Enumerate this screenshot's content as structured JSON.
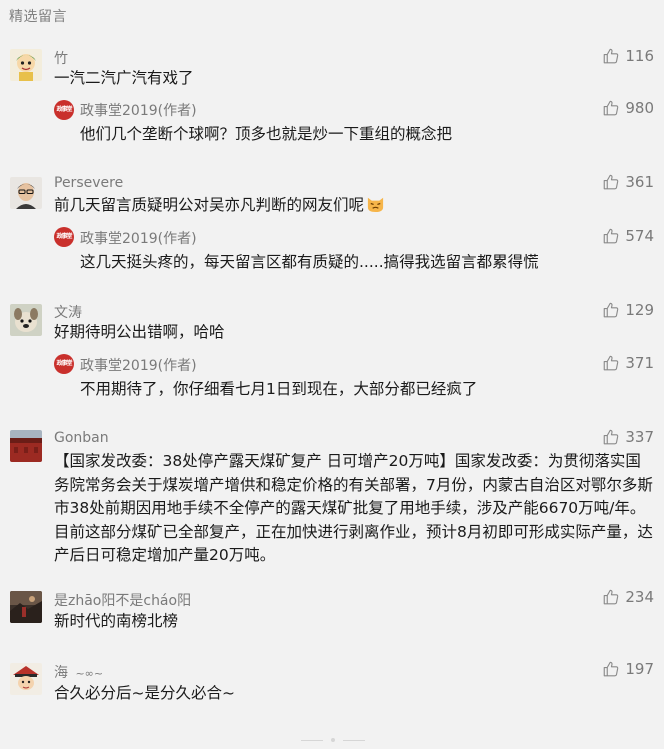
{
  "section_title": "精选留言",
  "comments": [
    {
      "nick": "竹",
      "text": "一汽二汽广汽有戏了",
      "likes": "116",
      "avatar_icon": "cartoon-character-avatar",
      "reply": {
        "nick": "政事堂2019(作者)",
        "text": "他们几个垄断个球啊？顶多也就是炒一下重组的概念把",
        "likes": "980",
        "avatar_label": "政事堂"
      }
    },
    {
      "nick": "Persevere",
      "text": "前几天留言质疑明公对吴亦凡判断的网友们呢",
      "likes": "361",
      "avatar_icon": "person-photo-avatar",
      "emoji_icon": "smirk-cat-emoji",
      "reply": {
        "nick": "政事堂2019(作者)",
        "text": "这几天挺头疼的，每天留言区都有质疑的.....搞得我选留言都累得慌",
        "likes": "574",
        "avatar_label": "政事堂"
      }
    },
    {
      "nick": "文涛",
      "text": "好期待明公出错啊，哈哈",
      "likes": "129",
      "avatar_icon": "dog-photo-avatar",
      "reply": {
        "nick": "政事堂2019(作者)",
        "text": "不用期待了，你仔细看七月1日到现在，大部分都已经疯了",
        "likes": "371",
        "avatar_label": "政事堂"
      }
    },
    {
      "nick": "Gonban",
      "text": "【国家发改委：38处停产露天煤矿复产 日可增产20万吨】国家发改委：为贯彻落实国务院常务会关于煤炭增产增供和稳定价格的有关部署，7月份，内蒙古自治区对鄂尔多斯市38处前期因用地手续不全停产的露天煤矿批复了用地手续，涉及产能6670万吨/年。目前这部分煤矿已全部复产，正在加快进行剥离作业，预计8月初即可形成实际产量，达产后日可稳定增加产量20万吨。",
      "likes": "337",
      "avatar_icon": "red-building-photo-avatar"
    },
    {
      "nick": "是zhāo阳不是cháo阳",
      "text": "新时代的南榜北榜",
      "likes": "234",
      "avatar_icon": "landscape-photo-avatar"
    },
    {
      "nick": "海",
      "nick_suffix": "~∞~",
      "text": "合久必分后~是分久必合~",
      "likes": "197",
      "avatar_icon": "cartoon-hat-avatar"
    }
  ],
  "colors": {
    "background": "#f2f2f2",
    "muted": "#7a7a7a",
    "text": "#1a1a1a",
    "author_red": "#c9302c"
  },
  "like_icon": "thumbs-up-icon"
}
